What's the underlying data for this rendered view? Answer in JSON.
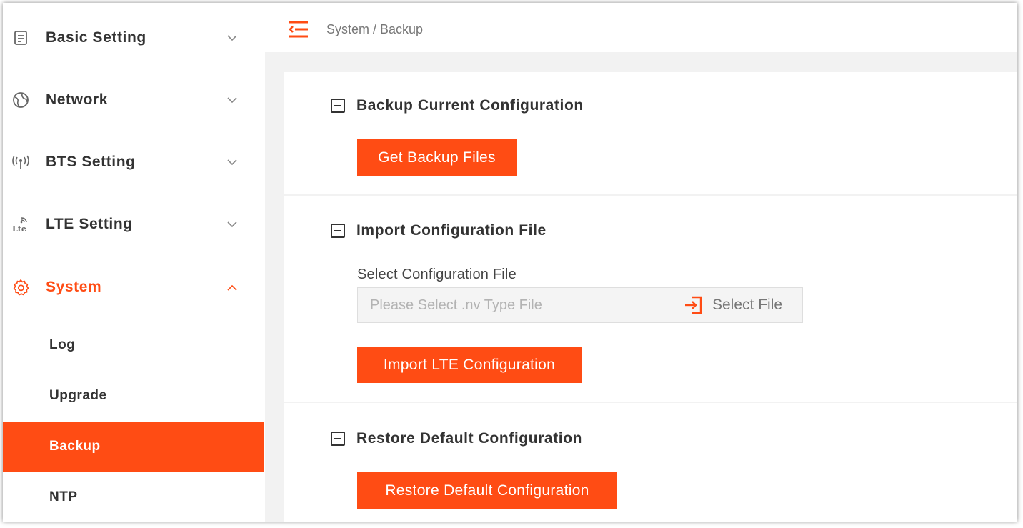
{
  "sidebar": {
    "menus": [
      {
        "label": "Basic Setting",
        "icon": "document-icon"
      },
      {
        "label": "Network",
        "icon": "globe-icon"
      },
      {
        "label": "BTS Setting",
        "icon": "antenna-icon"
      },
      {
        "label": "LTE Setting",
        "icon": "lte-icon"
      },
      {
        "label": "System",
        "icon": "gear-icon"
      }
    ],
    "system_submenu": [
      {
        "label": "Log"
      },
      {
        "label": "Upgrade"
      },
      {
        "label": "Backup"
      },
      {
        "label": "NTP"
      }
    ],
    "active_menu": "System",
    "selected_submenu": "Backup"
  },
  "header": {
    "breadcrumb": "System / Backup"
  },
  "sections": {
    "backup": {
      "title": "Backup Current Configuration",
      "button": "Get Backup Files"
    },
    "import": {
      "title": "Import Configuration File",
      "field_label": "Select Configuration File",
      "placeholder": "Please Select .nv Type File",
      "select_button": "Select File",
      "button": "Import LTE Configuration"
    },
    "restore": {
      "title": "Restore Default Configuration",
      "button": "Restore Default Configuration"
    }
  },
  "colors": {
    "accent": "#ff4c14",
    "text": "#333333",
    "muted": "#777777",
    "background": "#f2f2f2"
  }
}
